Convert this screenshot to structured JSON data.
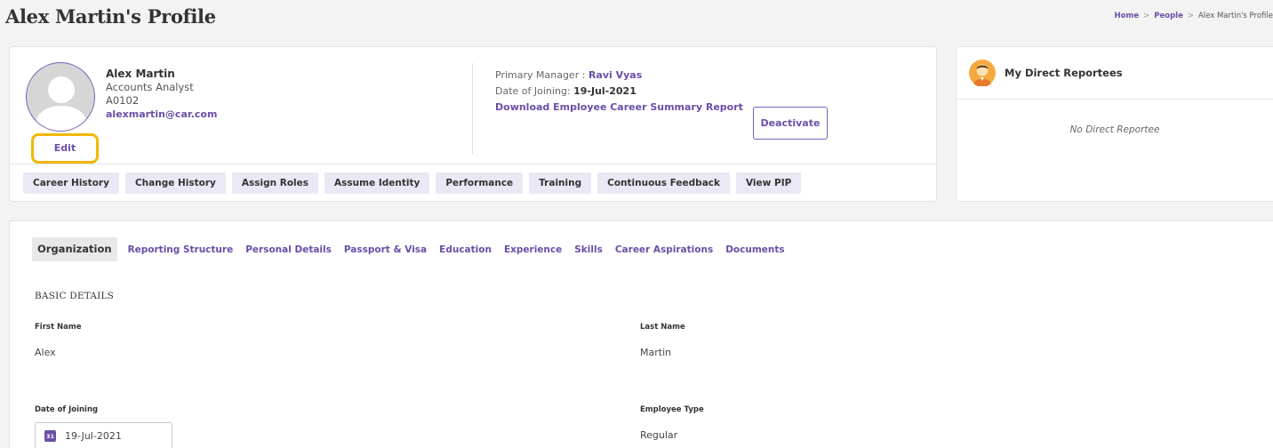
{
  "page": {
    "title": "Alex Martin's Profile"
  },
  "breadcrumb": {
    "home": "Home",
    "people": "People",
    "current": "Alex Martin's Profile",
    "sep": ">"
  },
  "profile": {
    "name": "Alex Martin",
    "designation": "Accounts Analyst",
    "employee_id": "A0102",
    "email": "alexmartin@car.com",
    "edit_label": "Edit",
    "primary_manager_label": "Primary Manager :",
    "primary_manager": "Ravi Vyas",
    "doj_label": "Date of Joining:",
    "doj": "19-Jul-2021",
    "download_report_label": "Download Employee Career Summary Report",
    "deactivate_label": "Deactivate"
  },
  "actions": [
    "Career History",
    "Change History",
    "Assign Roles",
    "Assume Identity",
    "Performance",
    "Training",
    "Continuous Feedback",
    "View PIP"
  ],
  "reportees": {
    "title": "My Direct Reportees",
    "empty_text": "No Direct Reportee",
    "icon": "user-avatar-icon"
  },
  "tabs": [
    "Organization",
    "Reporting Structure",
    "Personal Details",
    "Passport & Visa",
    "Education",
    "Experience",
    "Skills",
    "Career Aspirations",
    "Documents"
  ],
  "active_tab": "Organization",
  "basic_details": {
    "section_title": "BASIC DETAILS",
    "first_name_label": "First Name",
    "first_name": "Alex",
    "last_name_label": "Last Name",
    "last_name": "Martin",
    "doj_label": "Date of Joining",
    "doj": "19-Jul-2021",
    "employee_type_label": "Employee Type",
    "employee_type": "Regular"
  },
  "colors": {
    "accent": "#6b4ea8",
    "highlight": "#f2b705",
    "action_bg": "#ebe8f5"
  }
}
